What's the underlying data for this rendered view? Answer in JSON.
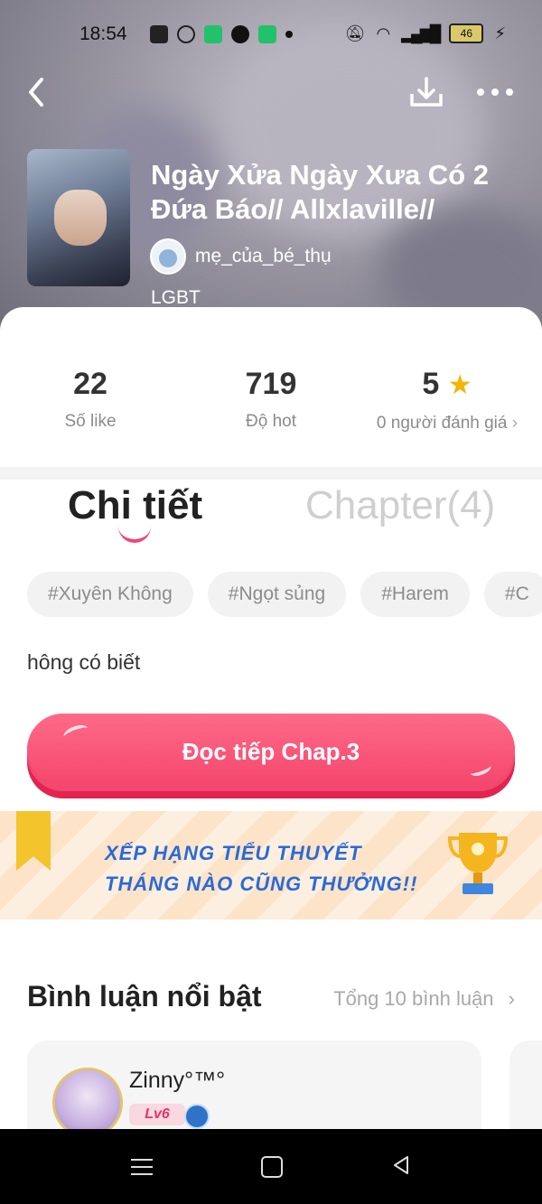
{
  "status_bar": {
    "time": "18:54",
    "battery": "46",
    "icons_left": [
      "facebook-icon",
      "edge-icon",
      "wechat-icon",
      "tiktok-icon",
      "messages-icon",
      "dot-icon"
    ],
    "icons_right": [
      "mute-icon",
      "wifi-icon",
      "signal-icon",
      "battery-icon",
      "charging-icon"
    ]
  },
  "header": {
    "title": "Ngày Xửa Ngày Xưa Có 2 Đứa Báo// Allxlaville//",
    "author": "mẹ_của_bé_thụ",
    "genre": "LGBT"
  },
  "stats": [
    {
      "value": "22",
      "label": "Số like"
    },
    {
      "value": "719",
      "label": "Độ hot"
    },
    {
      "value": "5",
      "label": "0 người đánh giá"
    }
  ],
  "tabs": {
    "detail": "Chi tiết",
    "chapters": "Chapter(4)"
  },
  "tags": [
    "#Xuyên Không",
    "#Ngọt sủng",
    "#Harem",
    "#C"
  ],
  "description": "hông có biết",
  "cta": "Đọc tiếp Chap.3",
  "banner": {
    "line1": "XẾP HẠNG TIỂU THUYẾT",
    "line2": "THÁNG NÀO CŨNG THƯỞNG!!"
  },
  "comments": {
    "title": "Bình luận nổi bật",
    "total": "Tổng 10 bình luận",
    "items": [
      {
        "name": "Zinny°™°",
        "level": "Lv6"
      }
    ]
  },
  "colors": {
    "accent": "#f2476e",
    "star": "#f5b400",
    "banner_text": "#2a6ad8"
  }
}
